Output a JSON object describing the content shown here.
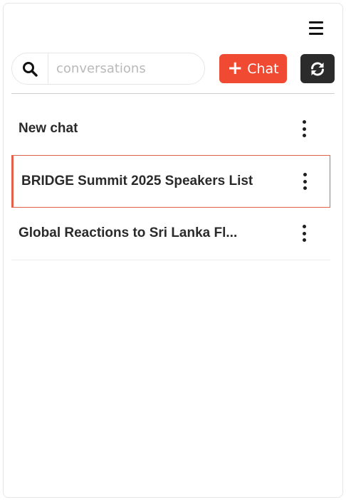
{
  "header": {
    "menu_icon": "hamburger-menu-icon"
  },
  "search": {
    "icon": "search-icon",
    "placeholder": "conversations",
    "value": ""
  },
  "toolbar": {
    "new_chat_label": "Chat",
    "new_chat_icon": "plus-icon",
    "refresh_icon": "refresh-icon",
    "accent_color": "#f04a32",
    "dark_color": "#2b2b2b"
  },
  "conversations": [
    {
      "title": "New chat",
      "active": false
    },
    {
      "title": "BRIDGE Summit 2025 Speakers List",
      "active": true
    },
    {
      "title": "Global Reactions to Sri Lanka Fl...",
      "active": false
    }
  ]
}
